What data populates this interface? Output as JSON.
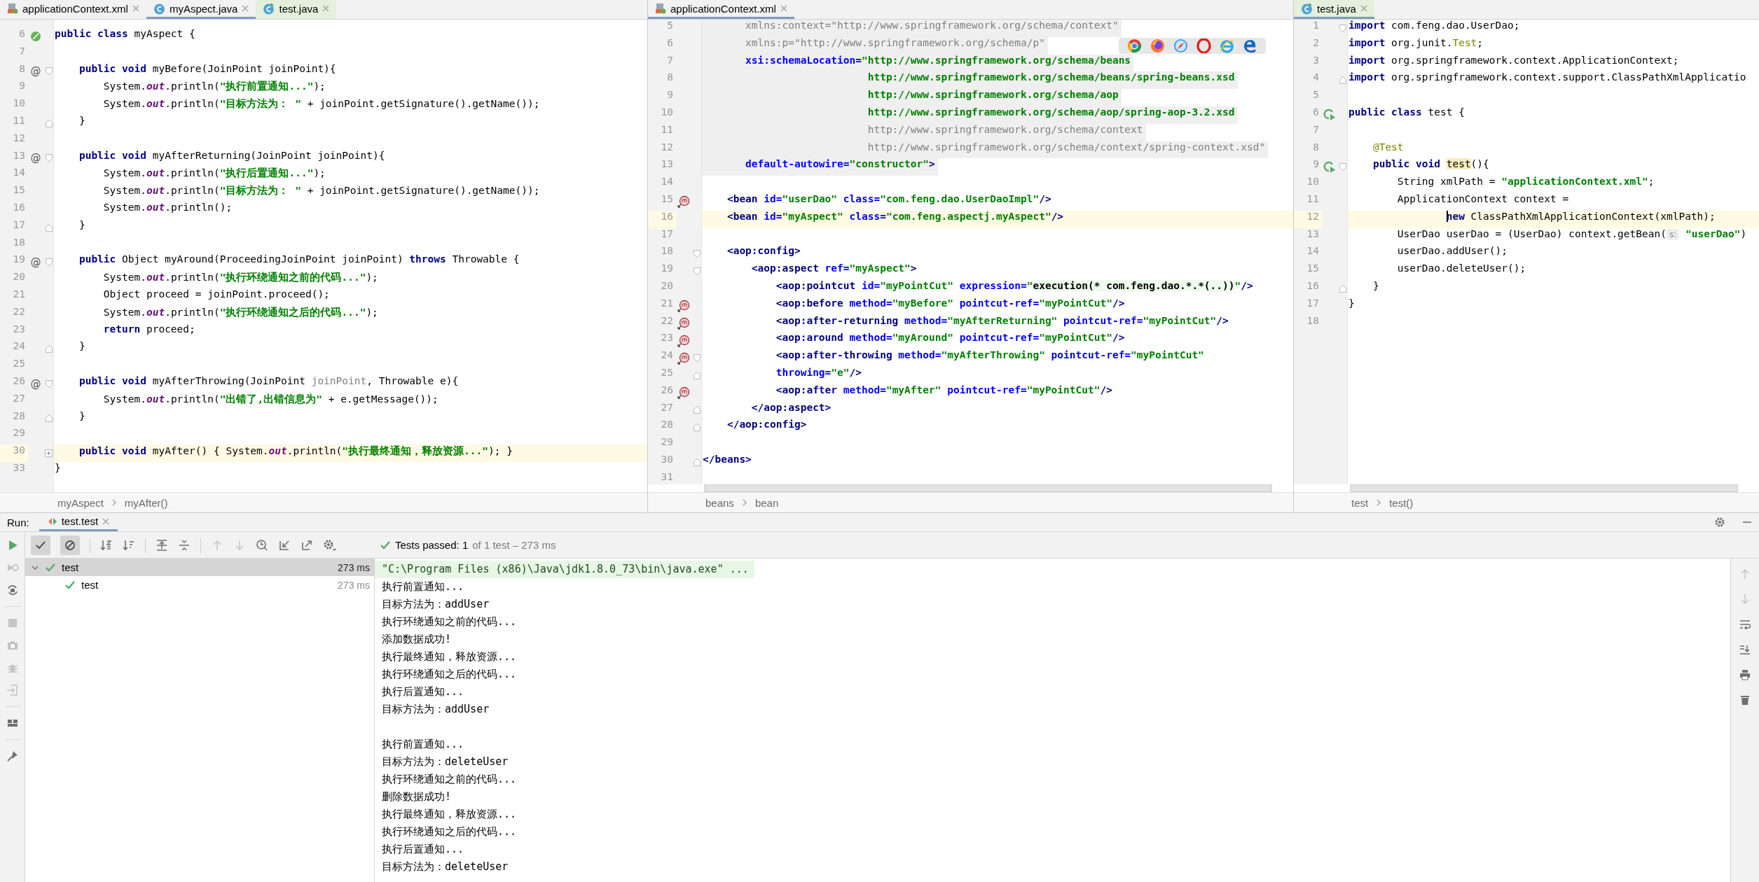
{
  "editors": [
    {
      "tabs": [
        {
          "label": "applicationContext.xml",
          "kind": "xml",
          "selected": false,
          "test_scope": false
        },
        {
          "label": "myAspect.java",
          "kind": "java",
          "selected": true,
          "test_scope": false
        },
        {
          "label": "test.java",
          "kind": "java",
          "selected": false,
          "test_scope": true
        }
      ],
      "lines": [
        {
          "num": "6",
          "marker": {
            "kind": "bean"
          },
          "tokens": [
            {
              "kind": "kw",
              "text": "public class"
            },
            {
              "kind": "plain",
              "text": " myAspect {"
            }
          ]
        },
        {
          "num": "7"
        },
        {
          "num": "8",
          "marker": {
            "kind": "advice",
            "glyph": "@"
          },
          "fold": {
            "kind": "start"
          },
          "tokens": [
            {
              "kind": "kw",
              "text": "    public void"
            },
            {
              "kind": "plain",
              "text": " myBefore(JoinPoint joinPoint){"
            }
          ]
        },
        {
          "num": "9",
          "tokens": [
            {
              "kind": "plain",
              "text": "        System."
            },
            {
              "kind": "field",
              "text": "out"
            },
            {
              "kind": "plain",
              "text": ".println("
            },
            {
              "kind": "str",
              "text": "\"执行前置通知...\""
            },
            {
              "kind": "plain",
              "text": ");"
            }
          ]
        },
        {
          "num": "10",
          "tokens": [
            {
              "kind": "plain",
              "text": "        System."
            },
            {
              "kind": "field",
              "text": "out"
            },
            {
              "kind": "plain",
              "text": ".println("
            },
            {
              "kind": "str",
              "text": "\"目标方法为： \""
            },
            {
              "kind": "plain",
              "text": " + joinPoint.getSignature().getName());"
            }
          ]
        },
        {
          "num": "11",
          "fold": {
            "kind": "end"
          },
          "tokens": [
            {
              "kind": "plain",
              "text": "    }"
            }
          ]
        },
        {
          "num": "12"
        },
        {
          "num": "13",
          "marker": {
            "kind": "advice",
            "glyph": "@"
          },
          "fold": {
            "kind": "start"
          },
          "tokens": [
            {
              "kind": "kw",
              "text": "    public void"
            },
            {
              "kind": "plain",
              "text": " myAfterReturning(JoinPoint joinPoint){"
            }
          ]
        },
        {
          "num": "14",
          "tokens": [
            {
              "kind": "plain",
              "text": "        System."
            },
            {
              "kind": "field",
              "text": "out"
            },
            {
              "kind": "plain",
              "text": ".println("
            },
            {
              "kind": "str",
              "text": "\"执行后置通知...\""
            },
            {
              "kind": "plain",
              "text": ");"
            }
          ]
        },
        {
          "num": "15",
          "tokens": [
            {
              "kind": "plain",
              "text": "        System."
            },
            {
              "kind": "field",
              "text": "out"
            },
            {
              "kind": "plain",
              "text": ".println("
            },
            {
              "kind": "str",
              "text": "\"目标方法为： \""
            },
            {
              "kind": "plain",
              "text": " + joinPoint.getSignature().getName());"
            }
          ]
        },
        {
          "num": "16",
          "tokens": [
            {
              "kind": "plain",
              "text": "        System."
            },
            {
              "kind": "field",
              "text": "out"
            },
            {
              "kind": "plain",
              "text": ".println();"
            }
          ]
        },
        {
          "num": "17",
          "fold": {
            "kind": "end"
          },
          "tokens": [
            {
              "kind": "plain",
              "text": "    }"
            }
          ]
        },
        {
          "num": "18"
        },
        {
          "num": "19",
          "marker": {
            "kind": "advice",
            "glyph": "@"
          },
          "fold": {
            "kind": "start"
          },
          "tokens": [
            {
              "kind": "kw",
              "text": "    public"
            },
            {
              "kind": "plain",
              "text": " Object myAround(ProceedingJoinPoint joinPoint) "
            },
            {
              "kind": "kw",
              "text": "throws"
            },
            {
              "kind": "plain",
              "text": " Throwable {"
            }
          ]
        },
        {
          "num": "20",
          "tokens": [
            {
              "kind": "plain",
              "text": "        System."
            },
            {
              "kind": "field",
              "text": "out"
            },
            {
              "kind": "plain",
              "text": ".println("
            },
            {
              "kind": "str",
              "text": "\"执行环绕通知之前的代码...\""
            },
            {
              "kind": "plain",
              "text": ");"
            }
          ]
        },
        {
          "num": "21",
          "tokens": [
            {
              "kind": "plain",
              "text": "        Object proceed = joinPoint.proceed();"
            }
          ]
        },
        {
          "num": "22",
          "tokens": [
            {
              "kind": "plain",
              "text": "        System."
            },
            {
              "kind": "field",
              "text": "out"
            },
            {
              "kind": "plain",
              "text": ".println("
            },
            {
              "kind": "str",
              "text": "\"执行环绕通知之后的代码...\""
            },
            {
              "kind": "plain",
              "text": ");"
            }
          ]
        },
        {
          "num": "23",
          "tokens": [
            {
              "kind": "kw",
              "text": "        return"
            },
            {
              "kind": "plain",
              "text": " proceed;"
            }
          ]
        },
        {
          "num": "24",
          "fold": {
            "kind": "end"
          },
          "tokens": [
            {
              "kind": "plain",
              "text": "    }"
            }
          ]
        },
        {
          "num": "25"
        },
        {
          "num": "26",
          "marker": {
            "kind": "advice",
            "glyph": "@"
          },
          "fold": {
            "kind": "start"
          },
          "tokens": [
            {
              "kind": "kw",
              "text": "    public void"
            },
            {
              "kind": "plain",
              "text": " myAfterThrowing(JoinPoint "
            },
            {
              "kind": "unused",
              "text": "joinPoint"
            },
            {
              "kind": "plain",
              "text": ", Throwable e){"
            }
          ]
        },
        {
          "num": "27",
          "tokens": [
            {
              "kind": "plain",
              "text": "        System."
            },
            {
              "kind": "field",
              "text": "out"
            },
            {
              "kind": "plain",
              "text": ".println("
            },
            {
              "kind": "str",
              "text": "\"出错了,出错信息为\""
            },
            {
              "kind": "plain",
              "text": " + e.getMessage());"
            }
          ]
        },
        {
          "num": "28",
          "fold": {
            "kind": "end"
          },
          "tokens": [
            {
              "kind": "plain",
              "text": "    }"
            }
          ]
        },
        {
          "num": "29"
        },
        {
          "num": "30",
          "current": true,
          "fold": {
            "kind": "collapsed"
          },
          "tokens": [
            {
              "kind": "kw",
              "text": "    public void"
            },
            {
              "kind": "plain",
              "text": " myAfter() { System."
            },
            {
              "kind": "field",
              "text": "out"
            },
            {
              "kind": "plain",
              "text": ".println("
            },
            {
              "kind": "str",
              "text": "\"执行最终通知，释放资源...\""
            },
            {
              "kind": "plain",
              "text": "); }"
            }
          ]
        },
        {
          "num": "33",
          "tokens": [
            {
              "kind": "plain",
              "text": "}"
            }
          ]
        }
      ],
      "breadcrumbs": [
        "myAspect",
        "myAfter()"
      ]
    },
    {
      "browser_bar": true,
      "hscroll": true,
      "tabs": [
        {
          "label": "applicationContext.xml",
          "kind": "xml",
          "selected": true,
          "test_scope": false
        }
      ],
      "lines": [
        {
          "num": "5",
          "shaded": true,
          "tokens": [
            {
              "kind": "dim",
              "text": "       xmlns:context=\"http://www.springframework.org/schema/context\""
            }
          ]
        },
        {
          "num": "6",
          "shaded": true,
          "tokens": [
            {
              "kind": "dim",
              "text": "       xmlns:p=\"http://www.springframework.org/schema/p\""
            }
          ]
        },
        {
          "num": "7",
          "shaded": true,
          "tokens": [
            {
              "kind": "attr",
              "text": "       xsi:schemaLocation="
            },
            {
              "kind": "val",
              "text": "\"http://www.springframework.org/schema/beans"
            }
          ]
        },
        {
          "num": "8",
          "shaded": true,
          "tokens": [
            {
              "kind": "val",
              "text": "                           http://www.springframework.org/schema/beans/spring-beans.xsd"
            }
          ]
        },
        {
          "num": "9",
          "shaded": true,
          "tokens": [
            {
              "kind": "val",
              "text": "                           http://www.springframework.org/schema/aop"
            }
          ]
        },
        {
          "num": "10",
          "shaded": true,
          "tokens": [
            {
              "kind": "val",
              "text": "                           http://www.springframework.org/schema/aop/spring-aop-3.2.xsd"
            }
          ]
        },
        {
          "num": "11",
          "shaded": true,
          "tokens": [
            {
              "kind": "dim",
              "text": "                           http://www.springframework.org/schema/context"
            }
          ]
        },
        {
          "num": "12",
          "shaded": true,
          "tokens": [
            {
              "kind": "dim",
              "text": "                           http://www.springframework.org/schema/context/spring-context.xsd\""
            }
          ]
        },
        {
          "num": "13",
          "shaded": true,
          "tokens": [
            {
              "kind": "attr",
              "text": "       default-autowire="
            },
            {
              "kind": "val",
              "text": "\"constructor\""
            },
            {
              "kind": "tag",
              "text": ">"
            }
          ]
        },
        {
          "num": "14"
        },
        {
          "num": "15",
          "marker": {
            "kind": "method"
          },
          "tokens": [
            {
              "kind": "tag",
              "text": "    <bean"
            },
            {
              "kind": "attr",
              "text": " id="
            },
            {
              "kind": "val",
              "text": "\"userDao\""
            },
            {
              "kind": "attr",
              "text": " class="
            },
            {
              "kind": "val",
              "text": "\"com.feng.dao.UserDaoImpl\""
            },
            {
              "kind": "tag",
              "text": "/>"
            }
          ]
        },
        {
          "num": "16",
          "current": true,
          "tokens": [
            {
              "kind": "tag",
              "text": "    <bean"
            },
            {
              "kind": "attr",
              "text": " id="
            },
            {
              "kind": "val",
              "text": "\"myAspect\""
            },
            {
              "kind": "attr",
              "text": " class="
            },
            {
              "kind": "val",
              "text": "\"com.feng.aspectj.myAspect\""
            },
            {
              "kind": "tag",
              "text": "/>"
            }
          ]
        },
        {
          "num": "17"
        },
        {
          "num": "18",
          "fold": {
            "kind": "start"
          },
          "tokens": [
            {
              "kind": "tag",
              "text": "    <aop:config>"
            }
          ]
        },
        {
          "num": "19",
          "fold": {
            "kind": "start"
          },
          "tokens": [
            {
              "kind": "tag",
              "text": "        <aop:aspect"
            },
            {
              "kind": "attr",
              "text": " ref="
            },
            {
              "kind": "val",
              "text": "\"myAspect\""
            },
            {
              "kind": "tag",
              "text": ">"
            }
          ]
        },
        {
          "num": "20",
          "tokens": [
            {
              "kind": "tag",
              "text": "            <aop:pointcut"
            },
            {
              "kind": "attr",
              "text": " id="
            },
            {
              "kind": "val",
              "text": "\"myPointCut\""
            },
            {
              "kind": "attr",
              "text": " expression="
            },
            {
              "kind": "val",
              "text": "\""
            },
            {
              "kind": "inject",
              "text": "execution(* com.feng.dao.*.*(..))"
            },
            {
              "kind": "val",
              "text": "\""
            },
            {
              "kind": "tag",
              "text": "/>"
            }
          ]
        },
        {
          "num": "21",
          "marker": {
            "kind": "method"
          },
          "tokens": [
            {
              "kind": "tag",
              "text": "            <aop:before"
            },
            {
              "kind": "attr",
              "text": " method="
            },
            {
              "kind": "val",
              "text": "\"myBefore\""
            },
            {
              "kind": "attr",
              "text": " pointcut-ref="
            },
            {
              "kind": "val",
              "text": "\"myPointCut\""
            },
            {
              "kind": "tag",
              "text": "/>"
            }
          ]
        },
        {
          "num": "22",
          "marker": {
            "kind": "method"
          },
          "tokens": [
            {
              "kind": "tag",
              "text": "            <aop:after-returning"
            },
            {
              "kind": "attr",
              "text": " method="
            },
            {
              "kind": "val",
              "text": "\"myAfterReturning\""
            },
            {
              "kind": "attr",
              "text": " pointcut-ref="
            },
            {
              "kind": "val",
              "text": "\"myPointCut\""
            },
            {
              "kind": "tag",
              "text": "/>"
            }
          ]
        },
        {
          "num": "23",
          "marker": {
            "kind": "method"
          },
          "tokens": [
            {
              "kind": "tag",
              "text": "            <aop:around"
            },
            {
              "kind": "attr",
              "text": " method="
            },
            {
              "kind": "val",
              "text": "\"myAround\""
            },
            {
              "kind": "attr",
              "text": " pointcut-ref="
            },
            {
              "kind": "val",
              "text": "\"myPointCut\""
            },
            {
              "kind": "tag",
              "text": "/>"
            }
          ]
        },
        {
          "num": "24",
          "marker": {
            "kind": "method"
          },
          "fold": {
            "kind": "start"
          },
          "tokens": [
            {
              "kind": "tag",
              "text": "            <aop:after-throwing"
            },
            {
              "kind": "attr",
              "text": " method="
            },
            {
              "kind": "val",
              "text": "\"myAfterThrowing\""
            },
            {
              "kind": "attr",
              "text": " pointcut-ref="
            },
            {
              "kind": "val",
              "text": "\"myPointCut\""
            }
          ]
        },
        {
          "num": "25",
          "fold": {
            "kind": "end"
          },
          "tokens": [
            {
              "kind": "attr",
              "text": "            throwing="
            },
            {
              "kind": "val",
              "text": "\"e\""
            },
            {
              "kind": "tag",
              "text": "/>"
            }
          ]
        },
        {
          "num": "26",
          "marker": {
            "kind": "method"
          },
          "tokens": [
            {
              "kind": "tag",
              "text": "            <aop:after"
            },
            {
              "kind": "attr",
              "text": " method="
            },
            {
              "kind": "val",
              "text": "\"myAfter\""
            },
            {
              "kind": "attr",
              "text": " pointcut-ref="
            },
            {
              "kind": "val",
              "text": "\"myPointCut\""
            },
            {
              "kind": "tag",
              "text": "/>"
            }
          ]
        },
        {
          "num": "27",
          "fold": {
            "kind": "end"
          },
          "tokens": [
            {
              "kind": "tag",
              "text": "        </aop:aspect>"
            }
          ]
        },
        {
          "num": "28",
          "fold": {
            "kind": "end"
          },
          "tokens": [
            {
              "kind": "tag",
              "text": "    </aop:config>"
            }
          ]
        },
        {
          "num": "29"
        },
        {
          "num": "30",
          "fold": {
            "kind": "end"
          },
          "tokens": [
            {
              "kind": "tag",
              "text": "</beans>"
            }
          ]
        },
        {
          "num": "31"
        }
      ],
      "breadcrumbs": [
        "beans",
        "bean"
      ]
    },
    {
      "hscroll": true,
      "tabs": [
        {
          "label": "test.java",
          "kind": "java",
          "selected": true,
          "test_scope": true
        }
      ],
      "lines": [
        {
          "num": "1",
          "fold": {
            "kind": "start"
          },
          "tokens": [
            {
              "kind": "kw",
              "text": "import"
            },
            {
              "kind": "plain",
              "text": " com.feng.dao.UserDao;"
            }
          ]
        },
        {
          "num": "2",
          "tokens": [
            {
              "kind": "kw",
              "text": "import"
            },
            {
              "kind": "plain",
              "text": " org.junit."
            },
            {
              "kind": "ann",
              "text": "Test"
            },
            {
              "kind": "plain",
              "text": ";"
            }
          ]
        },
        {
          "num": "3",
          "tokens": [
            {
              "kind": "kw",
              "text": "import"
            },
            {
              "kind": "plain",
              "text": " org.springframework.context.ApplicationContext;"
            }
          ]
        },
        {
          "num": "4",
          "fold": {
            "kind": "end"
          },
          "tokens": [
            {
              "kind": "kw",
              "text": "import"
            },
            {
              "kind": "plain",
              "text": " org.springframework.context.support.ClassPathXmlApplicatio"
            }
          ]
        },
        {
          "num": "5"
        },
        {
          "num": "6",
          "marker": {
            "kind": "run"
          },
          "tokens": [
            {
              "kind": "kw",
              "text": "public class"
            },
            {
              "kind": "plain",
              "text": " test {"
            }
          ]
        },
        {
          "num": "7"
        },
        {
          "num": "8",
          "tokens": [
            {
              "kind": "ann",
              "text": "    @Test"
            }
          ]
        },
        {
          "num": "9",
          "marker": {
            "kind": "run"
          },
          "fold": {
            "kind": "start"
          },
          "tokens": [
            {
              "kind": "kw",
              "text": "    public void "
            },
            {
              "kind": "usage",
              "text": "test"
            },
            {
              "kind": "plain",
              "text": "(){"
            }
          ]
        },
        {
          "num": "10",
          "tokens": [
            {
              "kind": "plain",
              "text": "        String xmlPath = "
            },
            {
              "kind": "str",
              "text": "\"applicationContext.xml\""
            },
            {
              "kind": "plain",
              "text": ";"
            }
          ]
        },
        {
          "num": "11",
          "tokens": [
            {
              "kind": "plain",
              "text": "        ApplicationContext context ="
            }
          ]
        },
        {
          "num": "12",
          "current": true,
          "tokens": [
            {
              "kind": "kw",
              "text": "                new",
              "caret": true
            },
            {
              "kind": "plain",
              "text": " ClassPathXmlApplicationContext(xmlPath);"
            }
          ]
        },
        {
          "num": "13",
          "tokens": [
            {
              "kind": "plain",
              "text": "        UserDao userDao = (UserDao) context.getBean("
            },
            {
              "kind": "hint",
              "text": "s:"
            },
            {
              "kind": "str",
              "text": " \"userDao\""
            },
            {
              "kind": "plain",
              "text": ")"
            }
          ]
        },
        {
          "num": "14",
          "tokens": [
            {
              "kind": "plain",
              "text": "        userDao.addUser();"
            }
          ]
        },
        {
          "num": "15",
          "tokens": [
            {
              "kind": "plain",
              "text": "        userDao.deleteUser();"
            }
          ]
        },
        {
          "num": "16",
          "fold": {
            "kind": "end"
          },
          "tokens": [
            {
              "kind": "plain",
              "text": "    }"
            }
          ]
        },
        {
          "num": "17",
          "tokens": [
            {
              "kind": "plain",
              "text": "}"
            }
          ]
        },
        {
          "num": "18"
        }
      ],
      "breadcrumbs": [
        "test",
        "test()"
      ]
    }
  ],
  "run_panel": {
    "label": "Run:",
    "tab": {
      "label": "test.test",
      "selected": true
    },
    "toolbar": {
      "show_passed": true,
      "show_ignored": true
    },
    "status": {
      "title": "Tests passed: 1",
      "detail": "of 1 test – 273 ms"
    },
    "tests": [
      {
        "name": "test",
        "time": "273 ms",
        "kind": "passed",
        "selected": true,
        "expanded": true,
        "children": [
          {
            "name": "test",
            "time": "273 ms",
            "kind": "passed",
            "selected": false
          }
        ]
      }
    ],
    "console": [
      {
        "kind": "command",
        "text": "\"C:\\Program Files (x86)\\Java\\jdk1.8.0_73\\bin\\java.exe\" ..."
      },
      {
        "text": "执行前置通知..."
      },
      {
        "text": "目标方法为：addUser"
      },
      {
        "text": "执行环绕通知之前的代码..."
      },
      {
        "text": "添加数据成功!"
      },
      {
        "text": "执行最终通知，释放资源..."
      },
      {
        "text": "执行环绕通知之后的代码..."
      },
      {
        "text": "执行后置通知..."
      },
      {
        "text": "目标方法为：addUser"
      },
      {
        "kind": "blank"
      },
      {
        "text": "执行前置通知..."
      },
      {
        "text": "目标方法为：deleteUser"
      },
      {
        "text": "执行环绕通知之前的代码..."
      },
      {
        "text": "删除数据成功!"
      },
      {
        "text": "执行最终通知，释放资源..."
      },
      {
        "text": "执行环绕通知之后的代码..."
      },
      {
        "text": "执行后置通知..."
      },
      {
        "text": "目标方法为：deleteUser"
      }
    ]
  }
}
